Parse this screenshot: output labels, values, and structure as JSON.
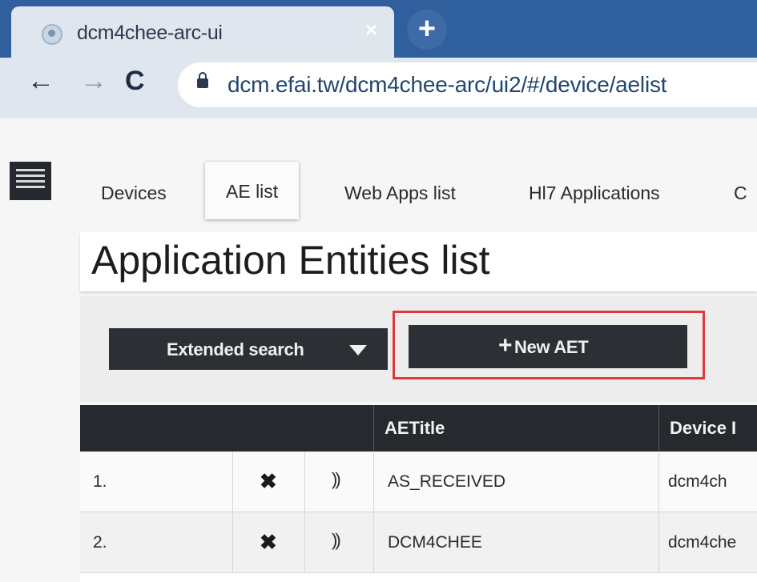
{
  "browser": {
    "tab_title": "dcm4chee-arc-ui",
    "tab_close": "×",
    "new_tab": "+",
    "back": "←",
    "forward": "→",
    "reload": "C",
    "url": "dcm.efai.tw/dcm4chee-arc/ui2/#/device/aelist"
  },
  "nav": {
    "tabs": [
      {
        "label": "Devices",
        "active": false
      },
      {
        "label": "AE list",
        "active": true
      },
      {
        "label": "Web Apps list",
        "active": false
      },
      {
        "label": "Hl7 Applications",
        "active": false
      },
      {
        "label": "C",
        "active": false
      }
    ]
  },
  "page": {
    "title": "Application Entities list"
  },
  "search": {
    "extended_label": "Extended search",
    "new_aet_label": "New AET",
    "highlight_color": "#e23a3a"
  },
  "table": {
    "columns": [
      "",
      "AETitle",
      "Device I"
    ],
    "rows": [
      {
        "index": "1.",
        "delete": "✖",
        "echo": "))",
        "aetitle": "AS_RECEIVED",
        "device": "dcm4ch"
      },
      {
        "index": "2.",
        "delete": "✖",
        "echo": "))",
        "aetitle": "DCM4CHEE",
        "device": "dcm4che"
      }
    ]
  },
  "colors": {
    "chrome_blue": "#2f5f9c",
    "dark_button": "#2c2f33",
    "table_header": "#26292d"
  }
}
